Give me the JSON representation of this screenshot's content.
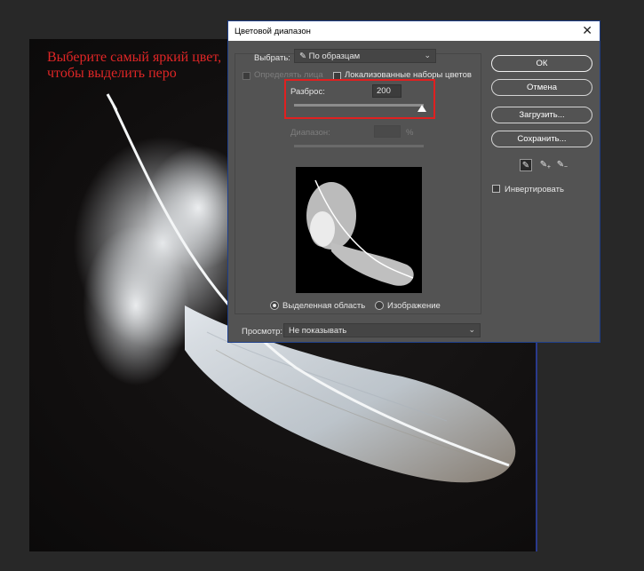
{
  "canvas": {
    "annotation_line1": "Выберите самый яркий цвет,",
    "annotation_line2": "чтобы выделить перо",
    "annotation_color": "#e02626"
  },
  "dialog": {
    "title": "Цветовой диапазон",
    "close_icon": "close-icon",
    "select_label": "Выбрать:",
    "select_value": "По образцам",
    "detect_faces_label": "Определять лица",
    "localized_label": "Локализованные наборы цветов",
    "fuzziness_label": "Разброс:",
    "fuzziness_value": "200",
    "fuzziness_max": 200,
    "range_label": "Диапазон:",
    "range_unit": "%",
    "radio_selection_label": "Выделенная область",
    "radio_image_label": "Изображение",
    "preview_label": "Просмотр:",
    "preview_value": "Не показывать",
    "buttons": {
      "ok": "ОК",
      "cancel": "Отмена",
      "load": "Загрузить...",
      "save": "Сохранить..."
    },
    "invert_label": "Инвертировать",
    "highlight_color": "#e02020",
    "accent_border": "#1e3f8a"
  }
}
